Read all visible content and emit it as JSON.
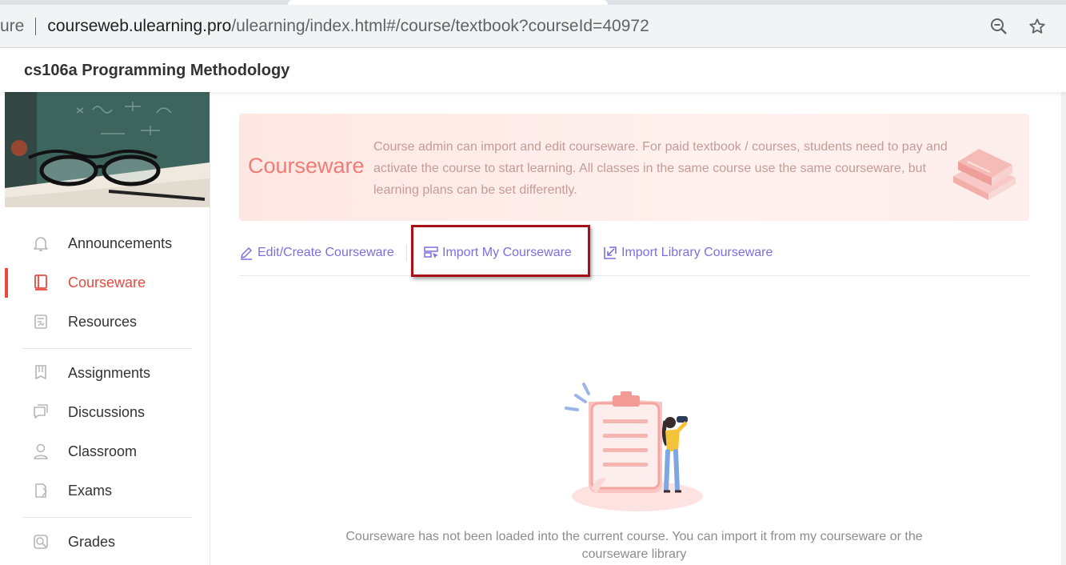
{
  "browser": {
    "url_prefix": "ure",
    "url_host": "courseweb.ulearning.pro",
    "url_path": "/ulearning/index.html#/course/textbook?courseId=40972",
    "icons": [
      "zoom-icon",
      "star-icon"
    ]
  },
  "header": {
    "course_title": "cs106a Programming Methodology"
  },
  "sidebar": {
    "items": [
      {
        "label": "Announcements",
        "icon": "bell-icon"
      },
      {
        "label": "Courseware",
        "icon": "book-icon",
        "active": true
      },
      {
        "label": "Resources",
        "icon": "resources-icon"
      },
      {
        "label": "Assignments",
        "icon": "assignment-icon"
      },
      {
        "label": "Discussions",
        "icon": "chat-icon"
      },
      {
        "label": "Classroom",
        "icon": "person-icon"
      },
      {
        "label": "Exams",
        "icon": "exam-icon"
      },
      {
        "label": "Grades",
        "icon": "grades-icon"
      }
    ]
  },
  "banner": {
    "title": "Courseware",
    "description": "Course admin can import and edit courseware. For paid textbook / courses, students need to pay and activate the course to start learning. All classes in the same course use the same courseware, but learning plans can be set differently."
  },
  "actions": {
    "edit_label": "Edit/Create Courseware",
    "import_my_label": "Import My Courseware",
    "import_library_label": "Import Library Courseware"
  },
  "empty_state": {
    "message": "Courseware has not been loaded into the current course. You can import it from my courseware or the courseware library"
  },
  "colors": {
    "accent_red": "#e8493d",
    "link_purple": "#7b6fe0",
    "highlight_border": "#a90f17",
    "banner_title": "#f07c74"
  }
}
